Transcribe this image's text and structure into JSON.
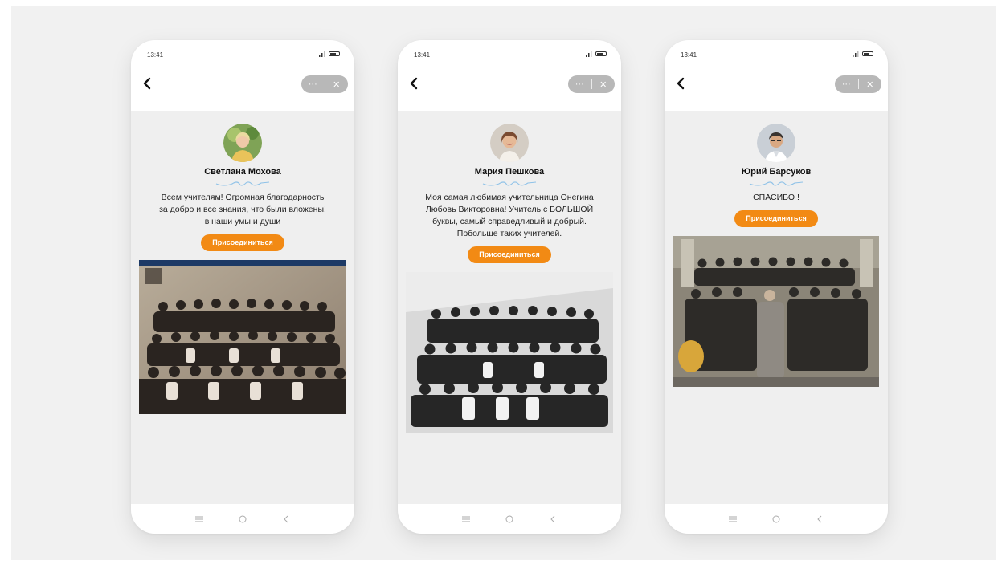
{
  "accent_color": "#f28a14",
  "phones": [
    {
      "status_time": "13:41",
      "author_name": "Светлана Мохова",
      "message_lines": [
        "Всем учителям! Огромная благодарность",
        "за добро и все знания, что были вложены!",
        "в наши умы и души"
      ],
      "join_label": "Присоединиться",
      "avatar_icon": "avatar-woman-photo",
      "photo_desc": "class-photo-sepia"
    },
    {
      "status_time": "13:41",
      "author_name": "Мария Пешкова",
      "message_lines": [
        "Моя самая любимая учительница Онегина",
        "Любовь Викторовна! Учитель с БОЛЬШОЙ",
        "буквы, самый справедливый и добрый.",
        "Побольше таких учителей."
      ],
      "join_label": "Присоединиться",
      "avatar_icon": "avatar-woman-photo",
      "photo_desc": "class-photo-bw"
    },
    {
      "status_time": "13:41",
      "author_name": "Юрий Барсуков",
      "message_lines": [
        "СПАСИБО !"
      ],
      "join_label": "Присоединиться",
      "avatar_icon": "avatar-man-photo",
      "photo_desc": "class-photo-outdoor"
    }
  ]
}
